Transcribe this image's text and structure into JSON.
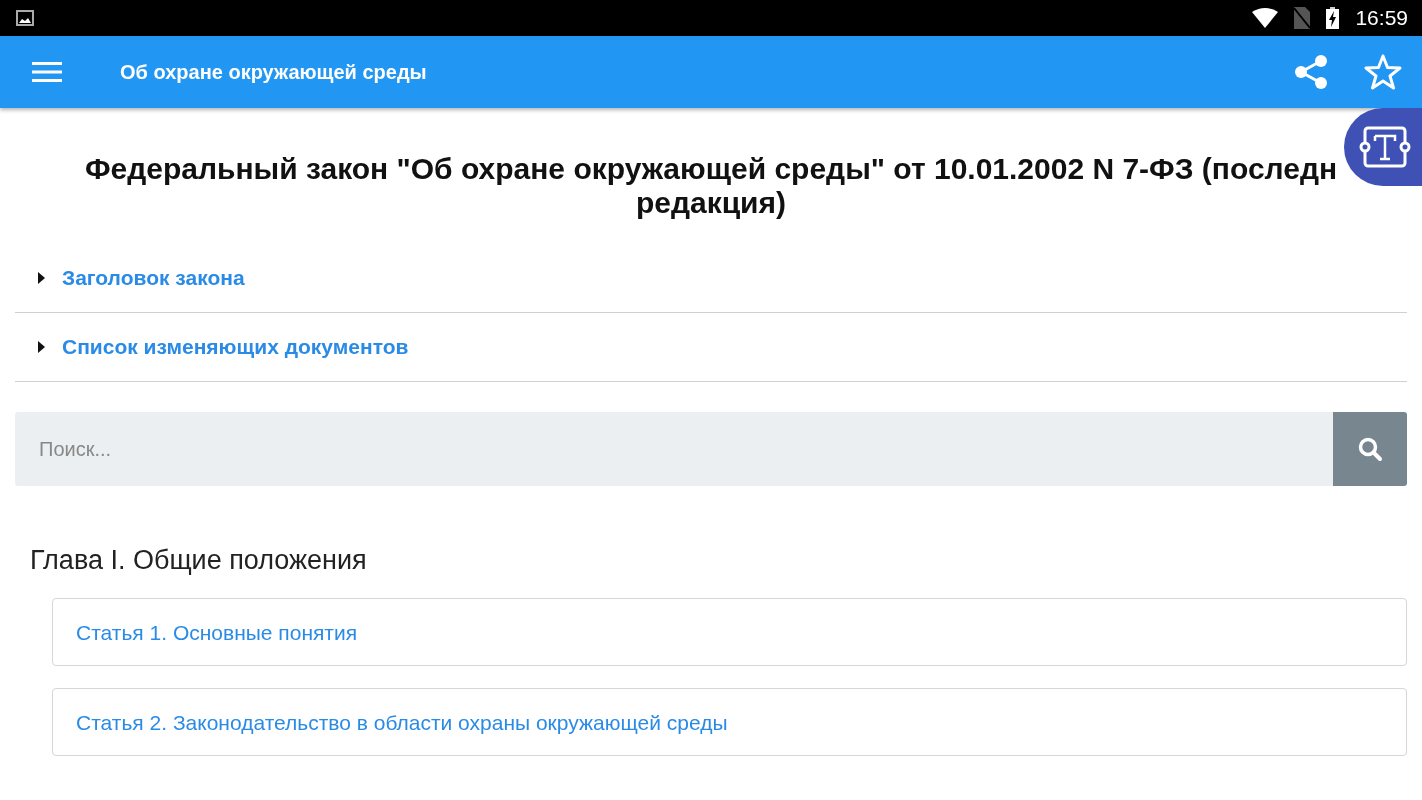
{
  "status_bar": {
    "time": "16:59"
  },
  "app_bar": {
    "title": "Об охране окружающей среды",
    "favorite": false
  },
  "document_title": [
    "Федеральный закон \"Об охране окружающей среды\" от 10.01.2002 N 7-ФЗ (последн",
    "редакция)"
  ],
  "sections": [
    {
      "label": "Заголовок закона",
      "expanded": false
    },
    {
      "label": "Список изменяющих документов",
      "expanded": false
    }
  ],
  "search": {
    "placeholder": "Поиск..."
  },
  "chapters": [
    {
      "title": "Глава I. Общие положения",
      "articles": [
        {
          "label": "Статья 1. Основные понятия"
        },
        {
          "label": "Статья 2. Законодательство в области охраны окружающей среды"
        }
      ]
    }
  ]
}
